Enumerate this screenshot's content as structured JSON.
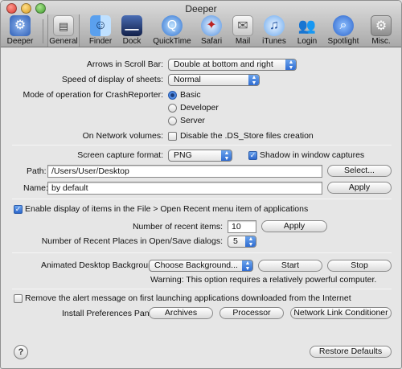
{
  "window": {
    "title": "Deeper"
  },
  "toolbar": {
    "items": [
      {
        "label": "Deeper",
        "icon": "gear-icon"
      },
      {
        "label": "General",
        "icon": "general-icon"
      },
      {
        "label": "Finder",
        "icon": "finder-icon"
      },
      {
        "label": "Dock",
        "icon": "dock-icon"
      },
      {
        "label": "QuickTime",
        "icon": "quicktime-icon"
      },
      {
        "label": "Safari",
        "icon": "safari-icon"
      },
      {
        "label": "Mail",
        "icon": "mail-icon"
      },
      {
        "label": "iTunes",
        "icon": "itunes-icon"
      },
      {
        "label": "Login",
        "icon": "login-icon"
      },
      {
        "label": "Spotlight",
        "icon": "spotlight-icon"
      },
      {
        "label": "Misc.",
        "icon": "misc-icon"
      }
    ],
    "selected": "General"
  },
  "section1": {
    "arrows_label": "Arrows in Scroll Bar:",
    "arrows_value": "Double at bottom and right",
    "speed_label": "Speed of display of sheets:",
    "speed_value": "Normal",
    "crash_label": "Mode of operation for CrashReporter:",
    "crash_options": [
      "Basic",
      "Developer",
      "Server"
    ],
    "crash_selected": "Basic",
    "network_label": "On Network volumes:",
    "network_checkbox": "Disable the .DS_Store files creation",
    "network_checked": false
  },
  "section2": {
    "format_label": "Screen capture format:",
    "format_value": "PNG",
    "shadow_checkbox": "Shadow in window captures",
    "shadow_checked": true,
    "path_label": "Path:",
    "path_value": "/Users/User/Desktop",
    "select_button": "Select...",
    "name_label": "Name:",
    "name_value": "by default",
    "apply_button": "Apply"
  },
  "section3": {
    "recent_checkbox": "Enable display of items in the File > Open Recent menu item of applications",
    "recent_checked": true,
    "recent_items_label": "Number of recent items:",
    "recent_items_value": "10",
    "apply_button": "Apply",
    "recent_places_label": "Number of Recent Places in Open/Save dialogs:",
    "recent_places_value": "5"
  },
  "section4": {
    "bg_label": "Animated Desktop Background:",
    "bg_value": "Choose Background...",
    "start_button": "Start",
    "stop_button": "Stop",
    "warning": "Warning: This option requires a relatively powerful computer."
  },
  "section5": {
    "alert_checkbox": "Remove the alert message on first launching applications downloaded from the Internet",
    "alert_checked": false,
    "install_label": "Install Preferences Pane:",
    "buttons": [
      "Archives",
      "Processor",
      "Network Link Conditioner"
    ]
  },
  "footer": {
    "help": "?",
    "restore_button": "Restore Defaults"
  },
  "colors": {
    "accent": "#2b68cf",
    "window_bg": "#e6e6e6"
  }
}
